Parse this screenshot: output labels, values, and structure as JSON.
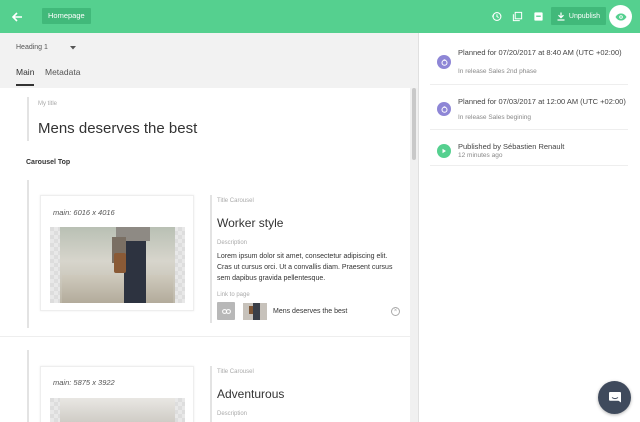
{
  "topbar": {
    "breadcrumb": "Homepage",
    "unpublish_label": "Unpublish",
    "colors": {
      "bar": "#55d08f",
      "button": "#41b97a"
    }
  },
  "editor": {
    "heading_select": "Heading 1",
    "tabs": [
      {
        "label": "Main",
        "active": true
      },
      {
        "label": "Metadata",
        "active": false
      }
    ],
    "title_label": "My title",
    "title_value": "Mens deserves the best",
    "section_title": "Carousel Top",
    "cards": [
      {
        "image_size": "main: 6016 x 4016",
        "title_label": "Title Carousel",
        "title_value": "Worker style",
        "description_label": "Description",
        "description": "Lorem ipsum dolor sit amet, consectetur adipiscing elit. Cras ut cursus orci. Ut a convallis diam. Praesent cursus sem dapibus gravida pellentesque.",
        "link_label": "Link to page",
        "link_page": "Mens deserves the best"
      },
      {
        "image_size": "main: 5875 x 3922",
        "title_label": "Title Carousel",
        "title_value": "Adventurous",
        "description_label": "Description"
      }
    ]
  },
  "releases": [
    {
      "title": "Planned for 07/20/2017 at 8:40 AM (UTC +02:00)",
      "subtitle": "In release Sales 2nd phase",
      "color": "#8e86d6"
    },
    {
      "title": "Planned for 07/03/2017 at 12:00 AM (UTC +02:00)",
      "subtitle": "In release Sales begining",
      "color": "#8e86d6"
    },
    {
      "title": "Published by Sébastien Renault",
      "subtitle": "12 minutes ago",
      "color": "#55d08f"
    }
  ]
}
